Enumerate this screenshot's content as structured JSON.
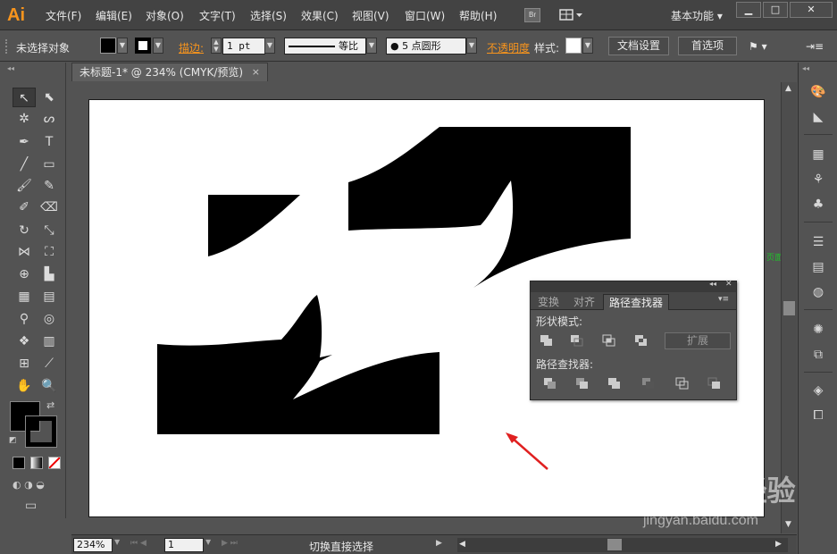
{
  "app": {
    "logo": "Ai"
  },
  "menu": [
    "文件(F)",
    "编辑(E)",
    "对象(O)",
    "文字(T)",
    "选择(S)",
    "效果(C)",
    "视图(V)",
    "窗口(W)",
    "帮助(H)"
  ],
  "menubar": {
    "bridge_label": "Br",
    "workspace": "基本功能",
    "minimize": "▁",
    "maximize": "□",
    "close": "✕"
  },
  "control": {
    "selection_status": "未选择对象",
    "stroke_label": "描边:",
    "stroke_weight": "1 pt",
    "stroke_profile": "等比",
    "brush": "5 点圆形",
    "opacity_label": "不透明度",
    "style_label": "样式:",
    "doc_setup": "文档设置",
    "preferences": "首选项"
  },
  "document": {
    "tab_title": "未标题-1* @ 234% (CMYK/预览)",
    "close": "×",
    "page_label": "页面"
  },
  "status": {
    "zoom": "234%",
    "page": "1",
    "text": "切换直接选择"
  },
  "pathfinder": {
    "tabs": [
      "变换",
      "对齐",
      "路径查找器"
    ],
    "shape_modes": "形状模式:",
    "pathfinders": "路径查找器:",
    "expand": "扩展"
  },
  "colors": {
    "accent_orange": "#f7941d",
    "arrow_red": "#e02020",
    "page_label_green": "#1fc22a"
  },
  "watermark": {
    "logo": "Bai du 经验",
    "url": "jingyan.baidu.com"
  }
}
